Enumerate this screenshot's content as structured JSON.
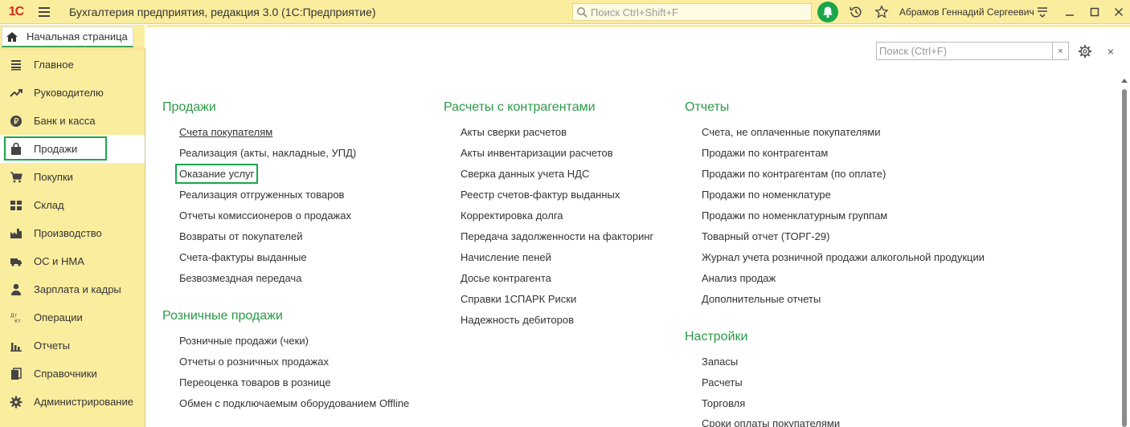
{
  "titlebar": {
    "logo": "1С",
    "title": "Бухгалтерия предприятия, редакция 3.0  (1С:Предприятие)",
    "search_placeholder": "Поиск Ctrl+Shift+F",
    "user": "Абрамов Геннадий Сергеевич",
    "accent": "#1aa64a"
  },
  "home_tab": {
    "label": "Начальная страница"
  },
  "sidebar": {
    "items": [
      {
        "label": "Главное",
        "icon": "list-icon"
      },
      {
        "label": "Руководителю",
        "icon": "trend-icon"
      },
      {
        "label": "Банк и касса",
        "icon": "ruble-coin-icon"
      },
      {
        "label": "Продажи",
        "icon": "shopping-bag-icon",
        "active": true
      },
      {
        "label": "Покупки",
        "icon": "cart-icon"
      },
      {
        "label": "Склад",
        "icon": "warehouse-icon"
      },
      {
        "label": "Производство",
        "icon": "factory-icon"
      },
      {
        "label": "ОС и НМА",
        "icon": "truck-icon"
      },
      {
        "label": "Зарплата и кадры",
        "icon": "person-icon"
      },
      {
        "label": "Операции",
        "icon": "dt-kt-icon"
      },
      {
        "label": "Отчеты",
        "icon": "bar-chart-icon"
      },
      {
        "label": "Справочники",
        "icon": "books-icon"
      },
      {
        "label": "Администрирование",
        "icon": "gear-icon"
      }
    ]
  },
  "panel": {
    "search_placeholder": "Поиск (Ctrl+F)",
    "clear_label": "×",
    "close_label": "×"
  },
  "sections": {
    "sales": {
      "title": "Продажи",
      "links": [
        "Счета покупателям",
        "Реализация (акты, накладные, УПД)",
        "Оказание услуг",
        "Реализация отгруженных товаров",
        "Отчеты комиссионеров о продажах",
        "Возвраты от покупателей",
        "Счета-фактуры выданные",
        "Безвозмездная передача"
      ]
    },
    "retail": {
      "title": "Розничные продажи",
      "links": [
        "Розничные продажи (чеки)",
        "Отчеты о розничных продажах",
        "Переоценка товаров в рознице",
        "Обмен с подключаемым оборудованием Offline"
      ]
    },
    "settlements": {
      "title": "Расчеты с контрагентами",
      "links": [
        "Акты сверки расчетов",
        "Акты инвентаризации расчетов",
        "Сверка данных учета НДС",
        "Реестр счетов-фактур выданных",
        "Корректировка долга",
        "Передача задолженности на факторинг",
        "Начисление пеней",
        "Досье контрагента",
        "Справки 1СПАРК Риски",
        "Надежность дебиторов"
      ]
    },
    "reports": {
      "title": "Отчеты",
      "links": [
        "Счета, не оплаченные покупателями",
        "Продажи по контрагентам",
        "Продажи по контрагентам (по оплате)",
        "Продажи по номенклатуре",
        "Продажи по номенклатурным группам",
        "Товарный отчет (ТОРГ-29)",
        "Журнал учета розничной продажи алкогольной продукции",
        "Анализ продаж",
        "Дополнительные отчеты"
      ]
    },
    "settings": {
      "title": "Настройки",
      "links": [
        "Запасы",
        "Расчеты",
        "Торговля",
        "Сроки оплаты покупателями"
      ]
    }
  }
}
